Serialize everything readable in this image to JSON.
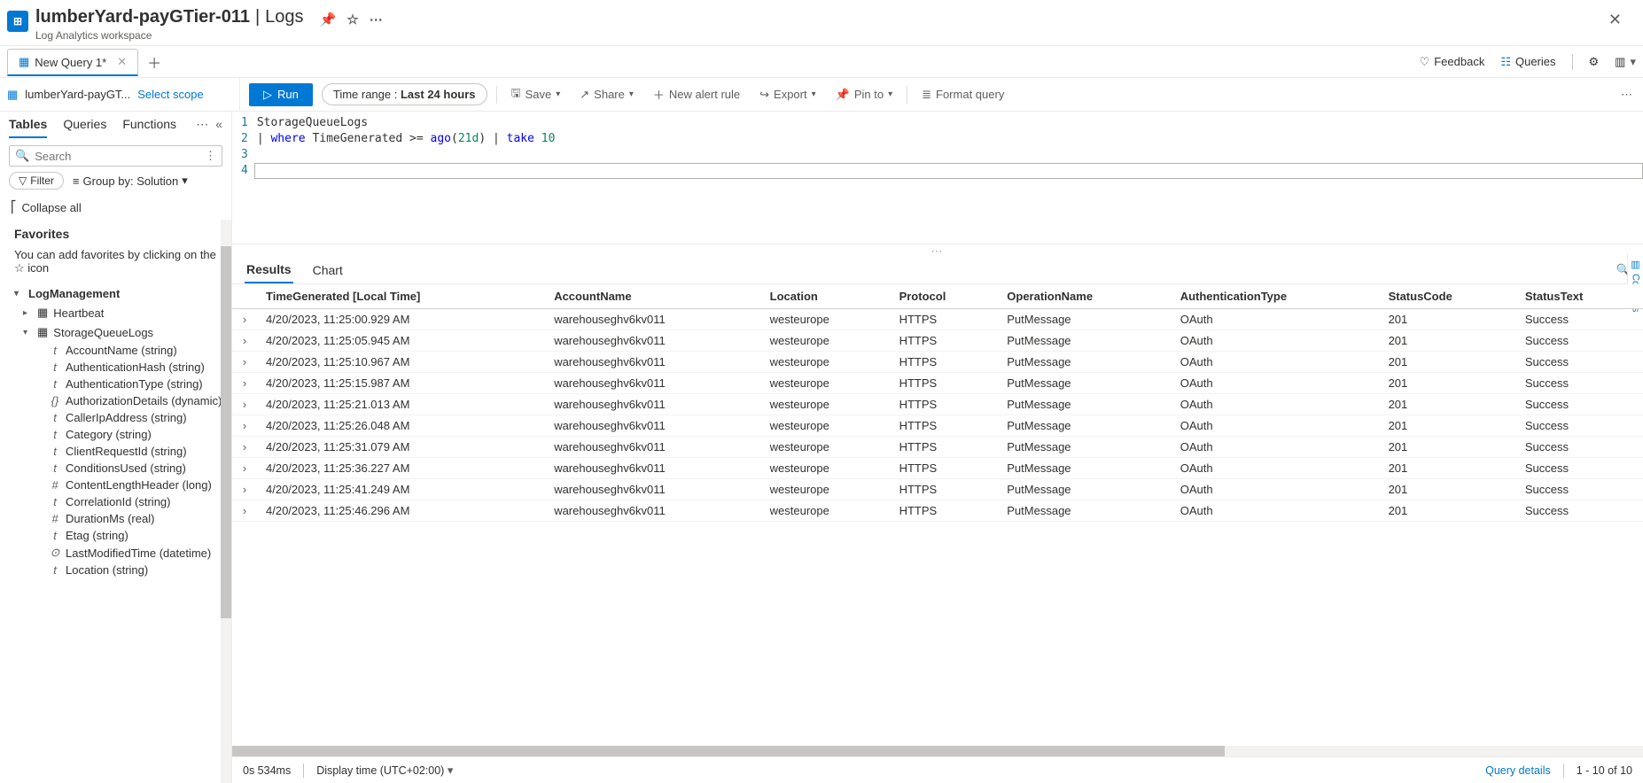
{
  "header": {
    "title_resource": "lumberYard-payGTier-011",
    "title_section": "Logs",
    "subtitle": "Log Analytics workspace"
  },
  "queryTab": {
    "label": "New Query 1*"
  },
  "topRight": {
    "feedback": "Feedback",
    "queries": "Queries"
  },
  "scope": {
    "workspace": "lumberYard-payGT...",
    "select": "Select scope"
  },
  "toolbar": {
    "run": "Run",
    "timerange_label": "Time range :",
    "timerange_value": "Last 24 hours",
    "save": "Save",
    "share": "Share",
    "newalert": "New alert rule",
    "export": "Export",
    "pinto": "Pin to",
    "format": "Format query"
  },
  "sidebar": {
    "tabs": {
      "tables": "Tables",
      "queries": "Queries",
      "functions": "Functions"
    },
    "search_ph": "Search",
    "filter": "Filter",
    "groupby": "Group by: Solution",
    "collapse": "Collapse all",
    "favorites": "Favorites",
    "fav_hint": "You can add favorites by clicking on the ☆ icon",
    "log_mgmt": "LogManagement",
    "heartbeat": "Heartbeat",
    "sql": "StorageQueueLogs",
    "fields": [
      {
        "t": "t",
        "n": "AccountName (string)"
      },
      {
        "t": "t",
        "n": "AuthenticationHash (string)"
      },
      {
        "t": "t",
        "n": "AuthenticationType (string)"
      },
      {
        "t": "{}",
        "n": "AuthorizationDetails (dynamic)"
      },
      {
        "t": "t",
        "n": "CallerIpAddress (string)"
      },
      {
        "t": "t",
        "n": "Category (string)"
      },
      {
        "t": "t",
        "n": "ClientRequestId (string)"
      },
      {
        "t": "t",
        "n": "ConditionsUsed (string)"
      },
      {
        "t": "#",
        "n": "ContentLengthHeader (long)"
      },
      {
        "t": "t",
        "n": "CorrelationId (string)"
      },
      {
        "t": "#",
        "n": "DurationMs (real)"
      },
      {
        "t": "t",
        "n": "Etag (string)"
      },
      {
        "t": "⊙",
        "n": "LastModifiedTime (datetime)"
      },
      {
        "t": "t",
        "n": "Location (string)"
      }
    ]
  },
  "editor": {
    "lines": [
      "StorageQueueLogs",
      "| where TimeGenerated >= ago(21d) | take 10",
      "",
      ""
    ]
  },
  "results": {
    "tab_results": "Results",
    "tab_chart": "Chart",
    "columns_btn": "Columns",
    "headers": [
      "TimeGenerated [Local Time]",
      "AccountName",
      "Location",
      "Protocol",
      "OperationName",
      "AuthenticationType",
      "StatusCode",
      "StatusText"
    ],
    "rows": [
      [
        "4/20/2023, 11:25:00.929 AM",
        "warehouseghv6kv011",
        "westeurope",
        "HTTPS",
        "PutMessage",
        "OAuth",
        "201",
        "Success"
      ],
      [
        "4/20/2023, 11:25:05.945 AM",
        "warehouseghv6kv011",
        "westeurope",
        "HTTPS",
        "PutMessage",
        "OAuth",
        "201",
        "Success"
      ],
      [
        "4/20/2023, 11:25:10.967 AM",
        "warehouseghv6kv011",
        "westeurope",
        "HTTPS",
        "PutMessage",
        "OAuth",
        "201",
        "Success"
      ],
      [
        "4/20/2023, 11:25:15.987 AM",
        "warehouseghv6kv011",
        "westeurope",
        "HTTPS",
        "PutMessage",
        "OAuth",
        "201",
        "Success"
      ],
      [
        "4/20/2023, 11:25:21.013 AM",
        "warehouseghv6kv011",
        "westeurope",
        "HTTPS",
        "PutMessage",
        "OAuth",
        "201",
        "Success"
      ],
      [
        "4/20/2023, 11:25:26.048 AM",
        "warehouseghv6kv011",
        "westeurope",
        "HTTPS",
        "PutMessage",
        "OAuth",
        "201",
        "Success"
      ],
      [
        "4/20/2023, 11:25:31.079 AM",
        "warehouseghv6kv011",
        "westeurope",
        "HTTPS",
        "PutMessage",
        "OAuth",
        "201",
        "Success"
      ],
      [
        "4/20/2023, 11:25:36.227 AM",
        "warehouseghv6kv011",
        "westeurope",
        "HTTPS",
        "PutMessage",
        "OAuth",
        "201",
        "Success"
      ],
      [
        "4/20/2023, 11:25:41.249 AM",
        "warehouseghv6kv011",
        "westeurope",
        "HTTPS",
        "PutMessage",
        "OAuth",
        "201",
        "Success"
      ],
      [
        "4/20/2023, 11:25:46.296 AM",
        "warehouseghv6kv011",
        "westeurope",
        "HTTPS",
        "PutMessage",
        "OAuth",
        "201",
        "Success"
      ]
    ]
  },
  "status": {
    "timing": "0s 534ms",
    "display": "Display time (UTC+02:00)",
    "query_details": "Query details",
    "pager": "1 - 10 of 10"
  }
}
